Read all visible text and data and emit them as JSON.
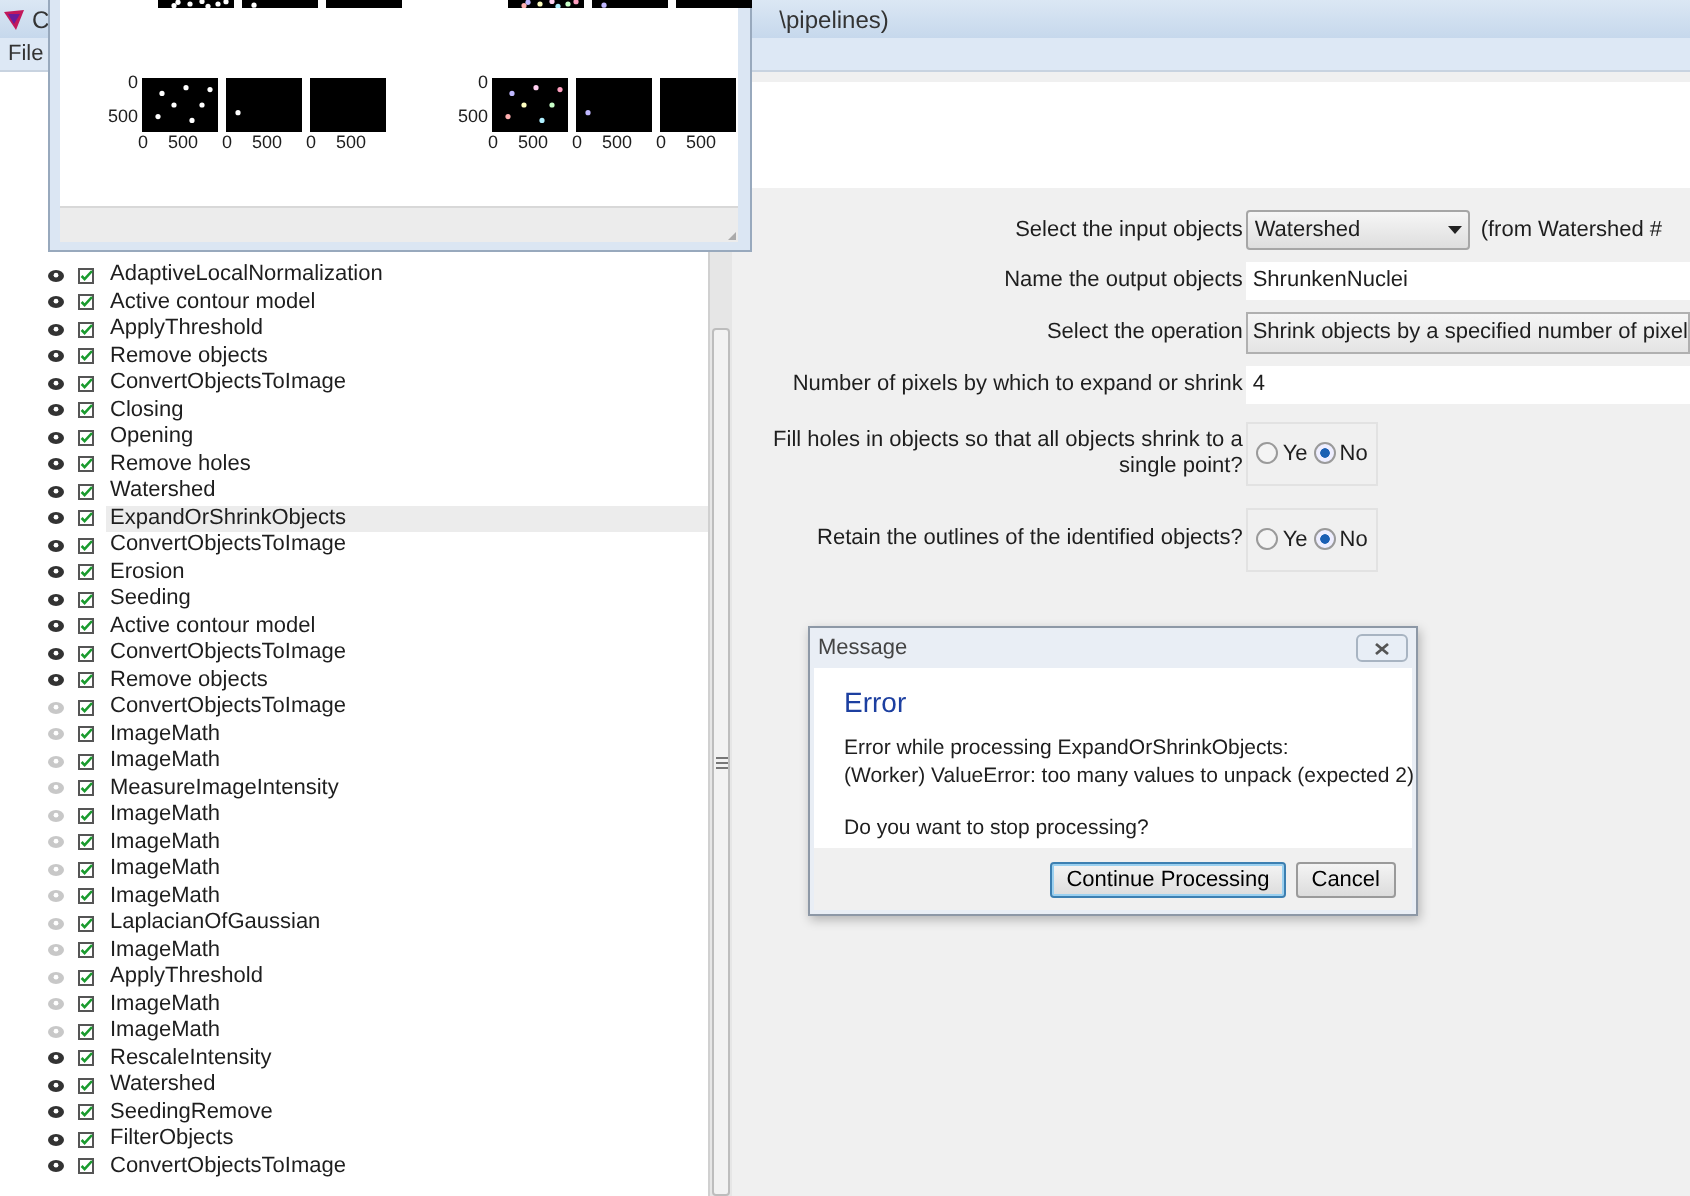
{
  "window": {
    "title_start": "C",
    "title_end": "\\pipelines)"
  },
  "menu": [
    "File"
  ],
  "figure": {
    "groups": [
      {
        "y_ticks": [
          "0",
          "500"
        ],
        "subplots": [
          {
            "x_ticks": [
              "0",
              "500"
            ]
          },
          {
            "x_ticks": [
              "0",
              "500"
            ]
          },
          {
            "x_ticks": [
              "0",
              "500"
            ]
          }
        ]
      },
      {
        "y_ticks": [
          "0",
          "500"
        ],
        "subplots": [
          {
            "x_ticks": [
              "0",
              "500"
            ]
          },
          {
            "x_ticks": [
              "0",
              "500"
            ]
          },
          {
            "x_ticks": [
              "0",
              "500"
            ]
          }
        ]
      }
    ]
  },
  "modules": [
    {
      "name": "AdaptiveLocalNormalization",
      "visible": true,
      "enabled": true,
      "selected": false
    },
    {
      "name": "Active contour model",
      "visible": true,
      "enabled": true,
      "selected": false
    },
    {
      "name": "ApplyThreshold",
      "visible": true,
      "enabled": true,
      "selected": false
    },
    {
      "name": "Remove objects",
      "visible": true,
      "enabled": true,
      "selected": false
    },
    {
      "name": "ConvertObjectsToImage",
      "visible": true,
      "enabled": true,
      "selected": false
    },
    {
      "name": "Closing",
      "visible": true,
      "enabled": true,
      "selected": false
    },
    {
      "name": "Opening",
      "visible": true,
      "enabled": true,
      "selected": false
    },
    {
      "name": "Remove holes",
      "visible": true,
      "enabled": true,
      "selected": false
    },
    {
      "name": "Watershed",
      "visible": true,
      "enabled": true,
      "selected": false
    },
    {
      "name": "ExpandOrShrinkObjects",
      "visible": true,
      "enabled": true,
      "selected": true
    },
    {
      "name": "ConvertObjectsToImage",
      "visible": true,
      "enabled": true,
      "selected": false
    },
    {
      "name": "Erosion",
      "visible": true,
      "enabled": true,
      "selected": false
    },
    {
      "name": "Seeding",
      "visible": true,
      "enabled": true,
      "selected": false
    },
    {
      "name": "Active contour model",
      "visible": true,
      "enabled": true,
      "selected": false
    },
    {
      "name": "ConvertObjectsToImage",
      "visible": true,
      "enabled": true,
      "selected": false
    },
    {
      "name": "Remove objects",
      "visible": true,
      "enabled": true,
      "selected": false
    },
    {
      "name": "ConvertObjectsToImage",
      "visible": false,
      "enabled": true,
      "selected": false
    },
    {
      "name": "ImageMath",
      "visible": false,
      "enabled": true,
      "selected": false
    },
    {
      "name": "ImageMath",
      "visible": false,
      "enabled": true,
      "selected": false
    },
    {
      "name": "MeasureImageIntensity",
      "visible": false,
      "enabled": true,
      "selected": false
    },
    {
      "name": "ImageMath",
      "visible": false,
      "enabled": true,
      "selected": false
    },
    {
      "name": "ImageMath",
      "visible": false,
      "enabled": true,
      "selected": false
    },
    {
      "name": "ImageMath",
      "visible": false,
      "enabled": true,
      "selected": false
    },
    {
      "name": "ImageMath",
      "visible": false,
      "enabled": true,
      "selected": false
    },
    {
      "name": "LaplacianOfGaussian",
      "visible": false,
      "enabled": true,
      "selected": false
    },
    {
      "name": "ImageMath",
      "visible": false,
      "enabled": true,
      "selected": false
    },
    {
      "name": "ApplyThreshold",
      "visible": false,
      "enabled": true,
      "selected": false
    },
    {
      "name": "ImageMath",
      "visible": false,
      "enabled": true,
      "selected": false
    },
    {
      "name": "ImageMath",
      "visible": false,
      "enabled": true,
      "selected": false
    },
    {
      "name": "RescaleIntensity",
      "visible": true,
      "enabled": true,
      "selected": false
    },
    {
      "name": "Watershed",
      "visible": true,
      "enabled": true,
      "selected": false
    },
    {
      "name": "SeedingRemove",
      "visible": true,
      "enabled": true,
      "selected": false
    },
    {
      "name": "FilterObjects",
      "visible": true,
      "enabled": true,
      "selected": false
    },
    {
      "name": "ConvertObjectsToImage",
      "visible": true,
      "enabled": true,
      "selected": false
    }
  ],
  "settings": [
    {
      "kind": "dropdown",
      "label": "Select the input objects",
      "value": "Watershed",
      "note": "(from Watershed #"
    },
    {
      "kind": "text",
      "label": "Name the output objects",
      "value": "ShrunkenNuclei"
    },
    {
      "kind": "choice",
      "label": "Select the operation",
      "value": "Shrink objects by a specified number of pixel"
    },
    {
      "kind": "text",
      "label": "Number of pixels by which to expand or shrink",
      "value": "4"
    },
    {
      "kind": "radio",
      "label": "Fill holes in objects so that all objects shrink to a single point?",
      "options": [
        {
          "label": "Ye",
          "selected": false
        },
        {
          "label": "No",
          "selected": true
        }
      ]
    },
    {
      "kind": "radio",
      "label": "Retain the outlines of the identified objects?",
      "options": [
        {
          "label": "Ye",
          "selected": false
        },
        {
          "label": "No",
          "selected": true
        }
      ]
    }
  ],
  "dialog": {
    "title": "Message",
    "heading": "Error",
    "lines": [
      "Error while processing ExpandOrShrinkObjects:",
      "(Worker) ValueError: too many values to unpack (expected 2)"
    ],
    "question": "Do you want to stop processing?",
    "buttons": [
      {
        "label": "Continue Processing",
        "default": true
      },
      {
        "label": "Cancel",
        "default": false
      }
    ]
  }
}
